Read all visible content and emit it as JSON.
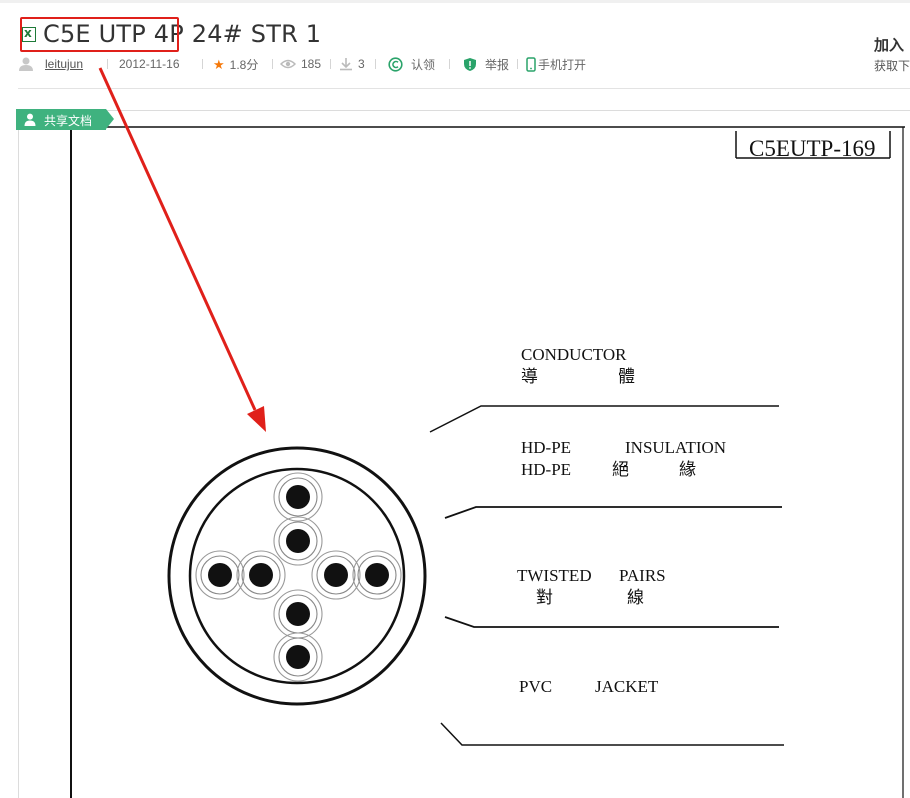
{
  "header": {
    "file_type_icon": "excel-file-icon",
    "file_icon_glyph": "x",
    "title": "C5E UTP 4P 24# STR 1"
  },
  "meta": {
    "author": "leitujun",
    "date": "2012-11-16",
    "rating": "1.8分",
    "views": "185",
    "downloads": "3",
    "claim": "认领",
    "report": "举报",
    "mobile_open": "手机打开"
  },
  "right_panel": {
    "line1": "加入",
    "line2": "获取下"
  },
  "shared_tag": {
    "label": "共享文档"
  },
  "document": {
    "code": "C5EUTP-169",
    "labels": {
      "conductor_en": "CONDUCTOR",
      "conductor_cn1": "導",
      "conductor_cn2": "體",
      "insulation_en1": "HD-PE",
      "insulation_en2": "INSULATION",
      "insulation_en3": "HD-PE",
      "insulation_cn1": "絕",
      "insulation_cn2": "緣",
      "pairs_en1": "TWISTED",
      "pairs_en2": "PAIRS",
      "pairs_cn1": "對",
      "pairs_cn2": "線",
      "jacket_en1": "PVC",
      "jacket_en2": "JACKET"
    }
  },
  "colors": {
    "annotation_red": "#e0201a",
    "tag_green": "#3fb27f",
    "excel_green": "#1e7a38",
    "star_orange": "#f5780a"
  }
}
